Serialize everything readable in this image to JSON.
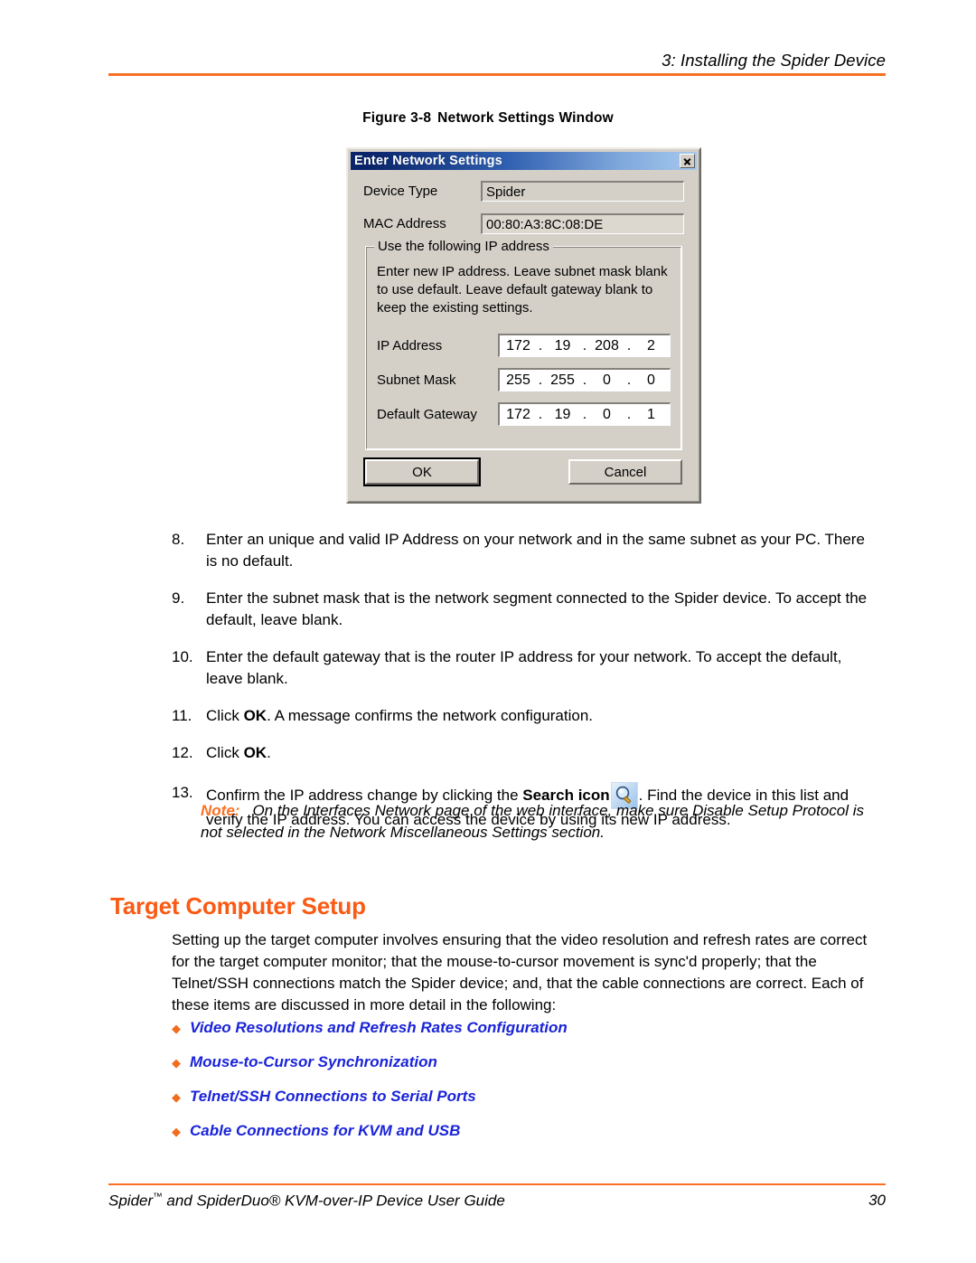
{
  "header": {
    "running_head": "3: Installing the Spider Device"
  },
  "figure": {
    "label": "Figure 3-8",
    "title": "Network Settings Window"
  },
  "dialog": {
    "title": "Enter Network Settings",
    "close_icon": "close-icon",
    "fields": [
      {
        "label": "Device Type",
        "value": "Spider"
      },
      {
        "label": "MAC Address",
        "value": "00:80:A3:8C:08:DE"
      }
    ],
    "group": {
      "title": "Use the following IP address",
      "description": "Enter new IP address. Leave subnet mask blank to use default. Leave default gateway blank to keep the existing settings.",
      "ip_rows": [
        {
          "label": "IP Address",
          "octets": [
            "172",
            "19",
            "208",
            "2"
          ]
        },
        {
          "label": "Subnet Mask",
          "octets": [
            "255",
            "255",
            "0",
            "0"
          ]
        },
        {
          "label": "Default Gateway",
          "octets": [
            "172",
            "19",
            "0",
            "1"
          ]
        }
      ]
    },
    "buttons": {
      "ok": "OK",
      "cancel": "Cancel"
    }
  },
  "steps": [
    {
      "number": "8.",
      "text": "Enter an unique and valid IP Address on your network and in the same subnet as your PC. There is no default."
    },
    {
      "number": "9.",
      "text": "Enter the subnet mask that is the network segment connected to the Spider device. To accept the default, leave blank."
    },
    {
      "number": "10.",
      "text": "Enter the default gateway that is the router IP address for your network. To accept the default, leave blank."
    },
    {
      "number": "11.",
      "text_pre": "Click ",
      "bold": "OK",
      "text_post": ". A message confirms the network configuration."
    },
    {
      "number": "12.",
      "text_pre": "Click ",
      "bold": "OK",
      "text_post": "."
    },
    {
      "number": "13.",
      "text_pre": "Confirm the IP address change by clicking the ",
      "bold": "Search icon",
      "icon": "search-icon",
      "text_post": ". Find the device in this list and verify the IP address. You can access the device by using its new IP address."
    }
  ],
  "note": {
    "label": "Note:",
    "text": "On the Interfaces Network page of the web interface, make sure Disable Setup Protocol is not selected in the Network Miscellaneous Settings section."
  },
  "section": {
    "heading": "Target Computer Setup",
    "paragraph": "Setting up the target computer involves ensuring that the video resolution and refresh rates are correct for the target computer monitor; that the mouse-to-cursor movement is sync'd properly; that the Telnet/SSH connections match the Spider device; and, that the cable connections are correct. Each of these items are discussed in more detail in the following:",
    "links": [
      "Video Resolutions and Refresh Rates Configuration",
      "Mouse-to-Cursor Synchronization",
      "Telnet/SSH Connections to Serial Ports",
      "Cable Connections for KVM and USB"
    ]
  },
  "footer": {
    "title_pre": "Spider",
    "title_post": " and SpiderDuo® KVM-over-IP Device User Guide",
    "page_number": "30"
  },
  "colors": {
    "accent_orange": "#FA7023",
    "heading_orange": "#FA5A14",
    "link_blue": "#1A24D8",
    "dialog_face": "#D4D0C8",
    "titlebar_start": "#0A246A",
    "titlebar_end": "#A6C8EE"
  }
}
